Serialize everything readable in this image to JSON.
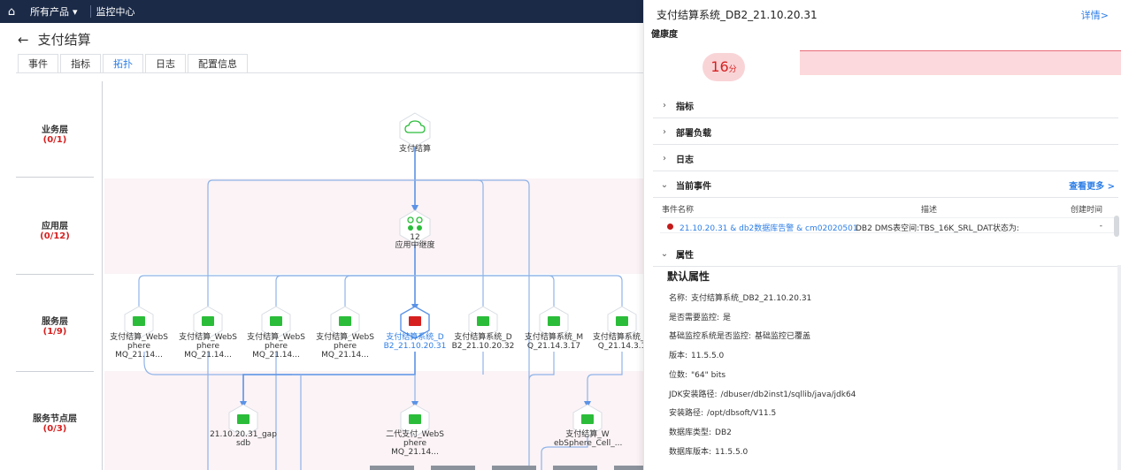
{
  "topbar": {
    "products_label": "所有产品",
    "monitor_label": "监控中心"
  },
  "page": {
    "title": "支付结算",
    "tabs": [
      {
        "label": "事件",
        "active": false
      },
      {
        "label": "指标",
        "active": false
      },
      {
        "label": "拓扑",
        "active": true
      },
      {
        "label": "日志",
        "active": false
      },
      {
        "label": "配置信息",
        "active": false
      }
    ]
  },
  "lanes": [
    {
      "label": "业务层",
      "count": "(0/1)"
    },
    {
      "label": "应用层",
      "count": "(0/12)"
    },
    {
      "label": "服务层",
      "count": "(1/9)"
    },
    {
      "label": "服务节点层",
      "count": "(0/3)"
    }
  ],
  "nodes": {
    "business": {
      "label": "支付结算"
    },
    "app": {
      "label1": "12",
      "label2": "应用中继度"
    },
    "services": [
      {
        "l1": "支付结算_WebS",
        "l2": "phere MQ_21.14...",
        "status": "ok"
      },
      {
        "l1": "支付结算_WebS",
        "l2": "phere MQ_21.14...",
        "status": "ok"
      },
      {
        "l1": "支付结算_WebS",
        "l2": "phere MQ_21.14...",
        "status": "ok"
      },
      {
        "l1": "支付结算_WebS",
        "l2": "phere MQ_21.14...",
        "status": "ok"
      },
      {
        "l1": "支付结算系统_D",
        "l2": "B2_21.10.20.31",
        "status": "error"
      },
      {
        "l1": "支付结算系统_D",
        "l2": "B2_21.10.20.32",
        "status": "ok"
      },
      {
        "l1": "支付结算系统_M",
        "l2": "Q_21.14.3.17",
        "status": "ok"
      },
      {
        "l1": "支付结算系统_M",
        "l2": "Q_21.14.3.1",
        "status": "ok"
      }
    ],
    "service_nodes": [
      {
        "l1": "21.10.20.31_gap",
        "l2": "sdb"
      },
      {
        "l1": "二代支付_WebS",
        "l2": "phere MQ_21.14..."
      },
      {
        "l1": "支付结算_W",
        "l2": "ebSphere_Cell_..."
      }
    ]
  },
  "panel": {
    "title": "支付结算系统_DB2_21.10.20.31",
    "detail_link": "详情>",
    "health_label": "健康度",
    "score": "16",
    "score_unit": "分",
    "sections": {
      "metrics": "指标",
      "deploy": "部署负载",
      "logs": "日志",
      "events": "当前事件",
      "props": "属性"
    },
    "more_link": "查看更多 >",
    "event_columns": {
      "name": "事件名称",
      "desc": "描述",
      "time": "创建时间"
    },
    "event_row": {
      "name": "21.10.20.31 & db2数据库告警 & cm02020501",
      "desc": "DB2 DMS表空间:TBS_16K_SRL_DAT状态为:",
      "time": "-"
    },
    "attr_title": "默认属性",
    "attributes": [
      {
        "key": "名称:",
        "value": "支付结算系统_DB2_21.10.20.31"
      },
      {
        "key": "是否需要监控:",
        "value": "是"
      },
      {
        "key": "基础监控系统是否监控:",
        "value": "基础监控已覆盖"
      },
      {
        "key": "版本:",
        "value": "11.5.5.0"
      },
      {
        "key": "位数:",
        "value": "\"64\" bits"
      },
      {
        "key": "JDK安装路径:",
        "value": "/dbuser/db2inst1/sqllib/java/jdk64"
      },
      {
        "key": "安装路径:",
        "value": "/opt/dbsoft/V11.5"
      },
      {
        "key": "数据库类型:",
        "value": "DB2"
      },
      {
        "key": "数据库版本:",
        "value": "11.5.5.0"
      }
    ]
  },
  "colors": {
    "accent": "#2d7ee6",
    "ok": "#2bbd3a",
    "error": "#d62020",
    "edge": "#8fb3e8"
  }
}
